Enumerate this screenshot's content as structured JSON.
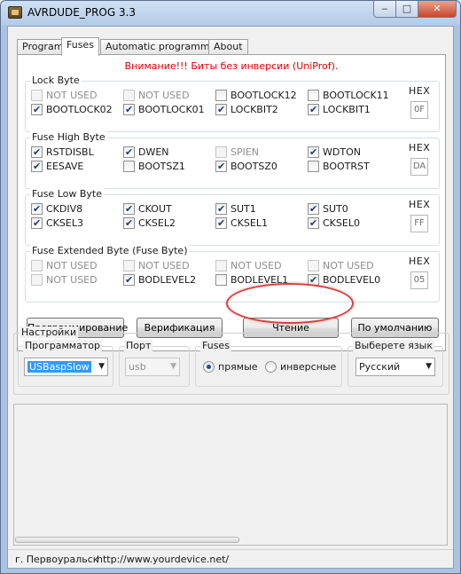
{
  "window": {
    "title": "AVRDUDE_PROG 3.3",
    "minimize": "‒",
    "maximize": "□",
    "close": "✕"
  },
  "tabs": [
    {
      "label": "Program"
    },
    {
      "label": "Fuses",
      "active": true
    },
    {
      "label": "Automatic programming"
    },
    {
      "label": "About"
    }
  ],
  "warning": "Внимание!!! Биты без инверсии (UniProf).",
  "hex_label": "HEX",
  "groups": {
    "lock": {
      "title": "Lock Byte",
      "hex": "0F",
      "bits": [
        {
          "label": "NOT USED",
          "checked": false,
          "disabled": true
        },
        {
          "label": "NOT USED",
          "checked": false,
          "disabled": true
        },
        {
          "label": "BOOTLOCK12",
          "checked": false,
          "disabled": false
        },
        {
          "label": "BOOTLOCK11",
          "checked": false,
          "disabled": false
        },
        {
          "label": "BOOTLOCK02",
          "checked": true,
          "disabled": false
        },
        {
          "label": "BOOTLOCK01",
          "checked": true,
          "disabled": false
        },
        {
          "label": "LOCKBIT2",
          "checked": true,
          "disabled": false
        },
        {
          "label": "LOCKBIT1",
          "checked": true,
          "disabled": false
        }
      ]
    },
    "high": {
      "title": "Fuse High Byte",
      "hex": "DA",
      "bits": [
        {
          "label": "RSTDISBL",
          "checked": true,
          "disabled": false
        },
        {
          "label": "DWEN",
          "checked": true,
          "disabled": false
        },
        {
          "label": "SPIEN",
          "checked": false,
          "disabled": true
        },
        {
          "label": "WDTON",
          "checked": true,
          "disabled": false
        },
        {
          "label": "EESAVE",
          "checked": true,
          "disabled": false
        },
        {
          "label": "BOOTSZ1",
          "checked": false,
          "disabled": false
        },
        {
          "label": "BOOTSZ0",
          "checked": true,
          "disabled": false
        },
        {
          "label": "BOOTRST",
          "checked": false,
          "disabled": false
        }
      ]
    },
    "low": {
      "title": "Fuse Low Byte",
      "hex": "FF",
      "bits": [
        {
          "label": "CKDIV8",
          "checked": true,
          "disabled": false
        },
        {
          "label": "CKOUT",
          "checked": true,
          "disabled": false
        },
        {
          "label": "SUT1",
          "checked": true,
          "disabled": false
        },
        {
          "label": "SUT0",
          "checked": true,
          "disabled": false
        },
        {
          "label": "CKSEL3",
          "checked": true,
          "disabled": false
        },
        {
          "label": "CKSEL2",
          "checked": true,
          "disabled": false
        },
        {
          "label": "CKSEL1",
          "checked": true,
          "disabled": false
        },
        {
          "label": "CKSEL0",
          "checked": true,
          "disabled": false
        }
      ]
    },
    "ext": {
      "title": "Fuse Extended Byte (Fuse Byte)",
      "hex": "05",
      "bits": [
        {
          "label": "NOT USED",
          "checked": false,
          "disabled": true
        },
        {
          "label": "NOT USED",
          "checked": false,
          "disabled": true
        },
        {
          "label": "NOT USED",
          "checked": false,
          "disabled": true
        },
        {
          "label": "NOT USED",
          "checked": false,
          "disabled": true
        },
        {
          "label": "NOT USED",
          "checked": false,
          "disabled": true
        },
        {
          "label": "BODLEVEL2",
          "checked": true,
          "disabled": false
        },
        {
          "label": "BODLEVEL1",
          "checked": false,
          "disabled": false
        },
        {
          "label": "BODLEVEL0",
          "checked": true,
          "disabled": false
        }
      ]
    }
  },
  "actions": {
    "program": "Программирование",
    "verify": "Верификация",
    "read": "Чтение",
    "default": "По умолчанию"
  },
  "settings": {
    "title": "Настройки",
    "programmer": {
      "title": "Программатор",
      "value": "USBaspSlow"
    },
    "port": {
      "title": "Порт",
      "value": "usb"
    },
    "fuses": {
      "title": "Fuses",
      "direct": "прямые",
      "inverse": "инверсные",
      "selected": "direct"
    },
    "language": {
      "title": "Выберете язык",
      "value": "Русский"
    }
  },
  "status": {
    "city": "г. Первоуральск",
    "url": "http://www.yourdevice.net/"
  },
  "colors": {
    "warning": "#e00000",
    "highlight": "#d84040",
    "selection": "#3399ff"
  }
}
